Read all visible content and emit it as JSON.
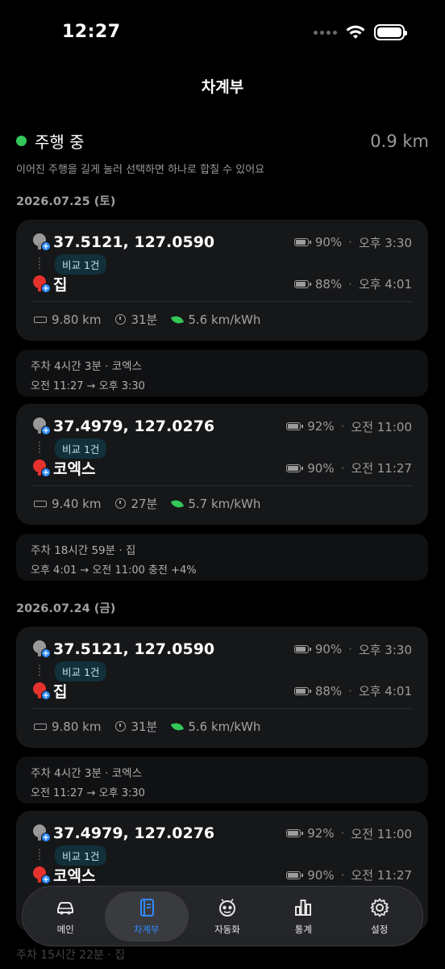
{
  "status": {
    "time": "12:27"
  },
  "title": "차계부",
  "driving": {
    "label": "주행 중",
    "distance": "0.9 km",
    "hint": "이어진 주행을 길게 눌러 선택하면 하나로 합칠 수 있어요"
  },
  "sections": [
    {
      "date": "2026.07.25 (토)",
      "trips": [
        {
          "start": {
            "name": "37.5121, 127.0590",
            "battery": "90%",
            "time": "오후 3:30"
          },
          "end": {
            "name": "집",
            "battery": "88%",
            "time": "오후 4:01"
          },
          "badge": "비교 1건",
          "distance": "9.80 km",
          "duration": "31분",
          "efficiency": "5.6 km/kWh",
          "parking": {
            "title": "주차 4시간 3분 · 코엑스",
            "range": "오전 11:27 → 오후 3:30"
          }
        },
        {
          "start": {
            "name": "37.4979, 127.0276",
            "battery": "92%",
            "time": "오전 11:00"
          },
          "end": {
            "name": "코엑스",
            "battery": "90%",
            "time": "오전 11:27"
          },
          "badge": "비교 1건",
          "distance": "9.40 km",
          "duration": "27분",
          "efficiency": "5.7 km/kWh",
          "parking": {
            "title": "주차 18시간 59분 · 집",
            "range": "오후 4:01 → 오전 11:00 충전 +4%"
          }
        }
      ]
    },
    {
      "date": "2026.07.24 (금)",
      "trips": [
        {
          "start": {
            "name": "37.5121, 127.0590",
            "battery": "90%",
            "time": "오후 3:30"
          },
          "end": {
            "name": "집",
            "battery": "88%",
            "time": "오후 4:01"
          },
          "badge": "비교 1건",
          "distance": "9.80 km",
          "duration": "31분",
          "efficiency": "5.6 km/kWh",
          "parking": {
            "title": "주차 4시간 3분 · 코엑스",
            "range": "오전 11:27 → 오후 3:30"
          }
        },
        {
          "start": {
            "name": "37.4979, 127.0276",
            "battery": "92%",
            "time": "오전 11:00"
          },
          "end": {
            "name": "코엑스",
            "battery": "90%",
            "time": "오전 11:27"
          },
          "badge": "비교 1건"
        }
      ]
    }
  ],
  "peek": "주차 15시간 22분 · 집",
  "tabs": [
    {
      "label": "메인",
      "icon": "car-icon"
    },
    {
      "label": "차계부",
      "icon": "logbook-icon"
    },
    {
      "label": "자동화",
      "icon": "automation-icon"
    },
    {
      "label": "통계",
      "icon": "chart-icon"
    },
    {
      "label": "설정",
      "icon": "gear-icon"
    }
  ],
  "accent": "#2f8bff",
  "driving_color": "#34c759"
}
